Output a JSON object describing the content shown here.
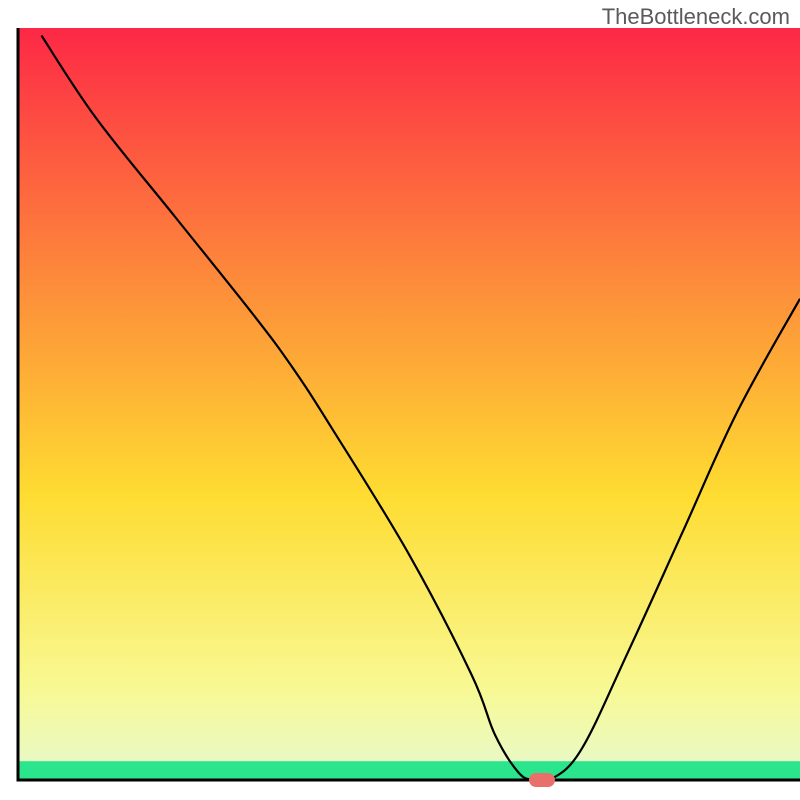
{
  "watermark": "TheBottleneck.com",
  "colors": {
    "gradient_top": "#fd2846",
    "gradient_mid_upper": "#fd8f3a",
    "gradient_mid": "#fedc31",
    "gradient_lower": "#f8f994",
    "gradient_green": "#2ae58b",
    "axis": "#000000",
    "curve": "#000000",
    "marker": "#e96f6a"
  },
  "chart_data": {
    "type": "line",
    "title": "",
    "xlabel": "",
    "ylabel": "",
    "xlim": [
      0,
      100
    ],
    "ylim": [
      0,
      100
    ],
    "x": [
      3,
      10,
      20,
      30,
      35,
      40,
      50,
      58,
      61,
      64,
      66,
      68,
      72,
      78,
      85,
      92,
      100
    ],
    "values": [
      99,
      88,
      75,
      62,
      55,
      47,
      30,
      14,
      6,
      1,
      0,
      0,
      4,
      17,
      33,
      49,
      64
    ],
    "marker": {
      "x": 67,
      "y": 0
    },
    "green_band_top_pct": 97.5,
    "axis_top_pct": 3.5,
    "axis_right_pct": 100
  }
}
